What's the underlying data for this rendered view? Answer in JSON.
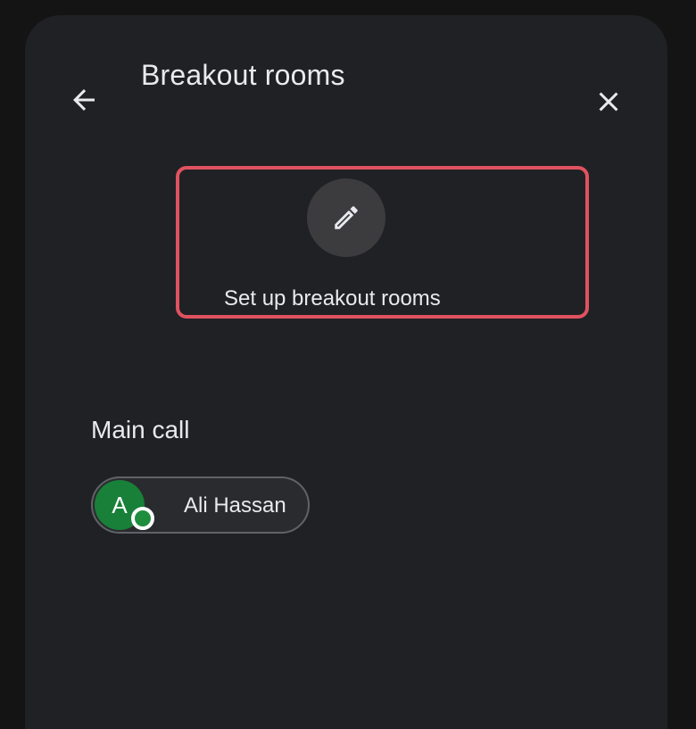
{
  "header": {
    "title": "Breakout rooms",
    "back_icon": "arrow-back-icon",
    "close_icon": "close-icon"
  },
  "setup": {
    "label": "Set up breakout rooms",
    "icon": "pencil-icon",
    "highlight_color": "#e05260"
  },
  "main_call": {
    "title": "Main call",
    "participants": [
      {
        "initial": "A",
        "name": "Ali Hassan",
        "avatar_color": "#188038",
        "status": "online"
      }
    ]
  }
}
